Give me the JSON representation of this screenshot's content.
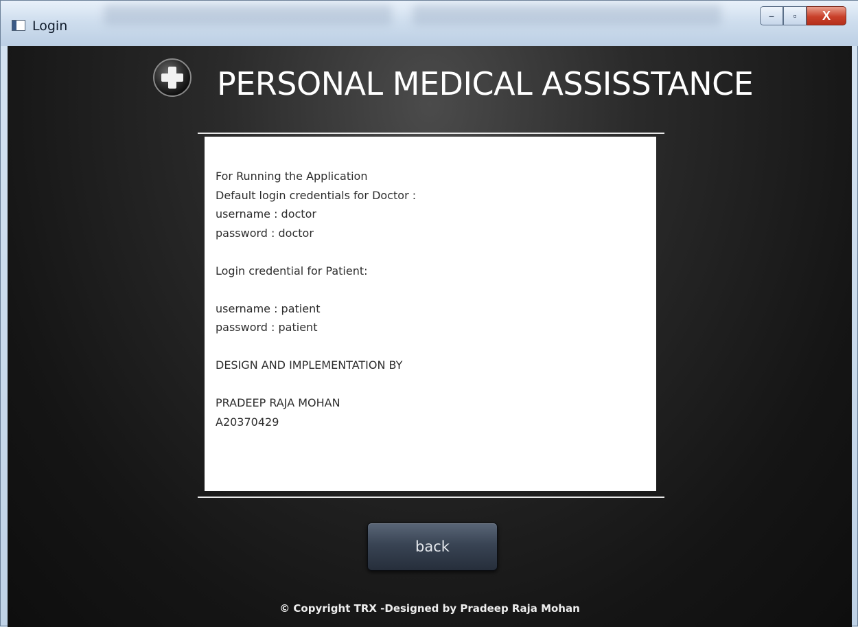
{
  "window": {
    "title": "Login",
    "minimize_glyph": "–",
    "maximize_glyph": "▫",
    "close_glyph": "X"
  },
  "header": {
    "title": "PERSONAL MEDICAL ASSISSTANCE",
    "logo_icon": "medical-cross-icon"
  },
  "info": {
    "lines": [
      "For Running the Application",
      "Default login credentials for Doctor :",
      "username : doctor",
      "password  : doctor",
      "",
      "Login credential for Patient:",
      "",
      "username : patient",
      "password  : patient",
      "",
      "DESIGN AND IMPLEMENTATION BY",
      "",
      "PRADEEP RAJA MOHAN",
      "A20370429"
    ]
  },
  "actions": {
    "back_label": "back"
  },
  "footer": {
    "copyright": "© Copyright TRX -Designed by Pradeep Raja Mohan"
  },
  "colors": {
    "background": "#151515",
    "panel": "#ffffff",
    "button": "#394454",
    "close": "#c9402a"
  }
}
